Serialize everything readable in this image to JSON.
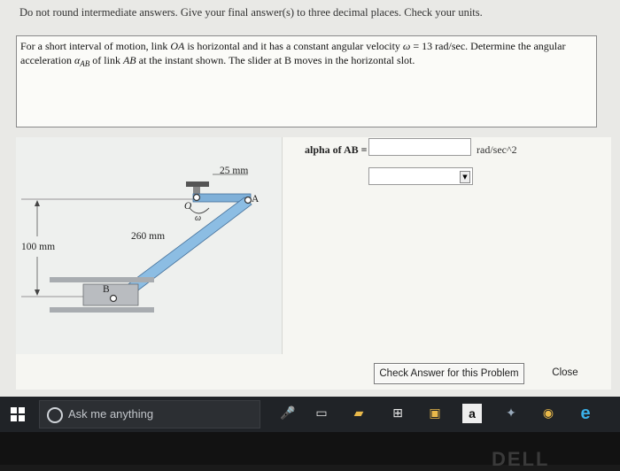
{
  "instructions": "Do not round intermediate answers.  Give your final answer(s) to three decimal places.  Check your units.",
  "problem": {
    "part1": "For a short interval of motion, link ",
    "link_oa": "OA",
    "part2": " is horizontal and it has a constant angular velocity ",
    "omega": "ω",
    "part3": " = 13 rad/sec. Determine the angular acceleration ",
    "alpha": "α",
    "alpha_sub": "AB",
    "part4": " of link ",
    "link_ab": "AB",
    "part5": " at the instant shown. The slider at B moves in the horizontal slot."
  },
  "figure": {
    "dim_top": "25 mm",
    "dim_link": "260 mm",
    "dim_height": "100 mm",
    "label_o": "O",
    "label_a": "A",
    "label_b": "B",
    "label_omega": "ω"
  },
  "answer": {
    "label": "alpha of AB =",
    "value": "",
    "unit_text": "rad/sec^2",
    "unit_select_value": ""
  },
  "buttons": {
    "check": "Check Answer for this Problem",
    "close": "Close"
  },
  "taskbar": {
    "search_placeholder": "Ask me anything",
    "icons": [
      "microphone-icon",
      "task-view-icon",
      "file-explorer-icon",
      "store-icon",
      "photos-icon",
      "amazon-icon",
      "app-icon",
      "chrome-icon",
      "edge-icon"
    ]
  },
  "bezel_logo": "DELL"
}
